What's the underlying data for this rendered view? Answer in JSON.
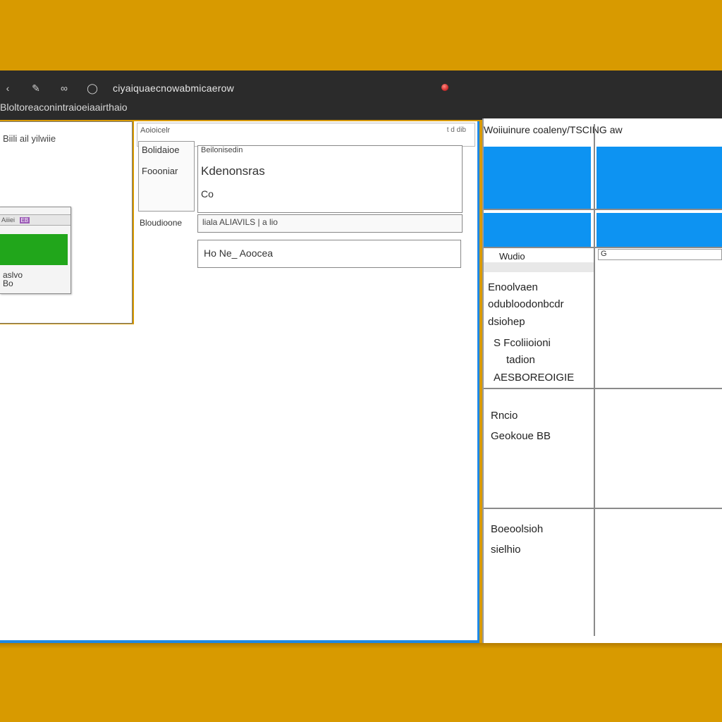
{
  "topbar": {
    "icons": [
      "back-icon",
      "pencil-icon",
      "link-icon",
      "globe-icon"
    ],
    "address": "ciyaiquaecnowabmicaerow",
    "subtitle": "Bloltoreaconintraioeiaairthaio"
  },
  "left_pane": {
    "title": "Biili ail yilwiie",
    "dialog": {
      "header": "Aiiiei",
      "badge": "EB",
      "label_line1": "aslvo",
      "label_line2": "Bo"
    }
  },
  "form": {
    "tab_name": "Aoioicelr",
    "tab_tools": "t d  dib",
    "labels": {
      "top": "Bolidaioe",
      "mid": "Foooniar",
      "bottom": "Bloudioone"
    },
    "field": {
      "caption": "Beilonisedin",
      "value": "Kdenonsras",
      "sub": "Co"
    },
    "input_a": "liala ALIAVILS | a lio",
    "input_b": "Ho Ne_ Aoocea"
  },
  "right_pane": {
    "title": "Woiiuinure coaleny/TSCING aw",
    "cell_header": "Wudio",
    "search_label": "G",
    "rows": [
      {
        "lines": [
          "Enoolvaen",
          "odubloodonbcdr",
          "dsiohep",
          "S Fcoliioioni",
          "tadion",
          "AESBOREOIGIE"
        ]
      },
      {
        "lines": [
          "Rncio",
          "Geokoue BB"
        ]
      },
      {
        "lines": [
          "Boeoolsioh",
          "sielhio"
        ]
      }
    ]
  }
}
